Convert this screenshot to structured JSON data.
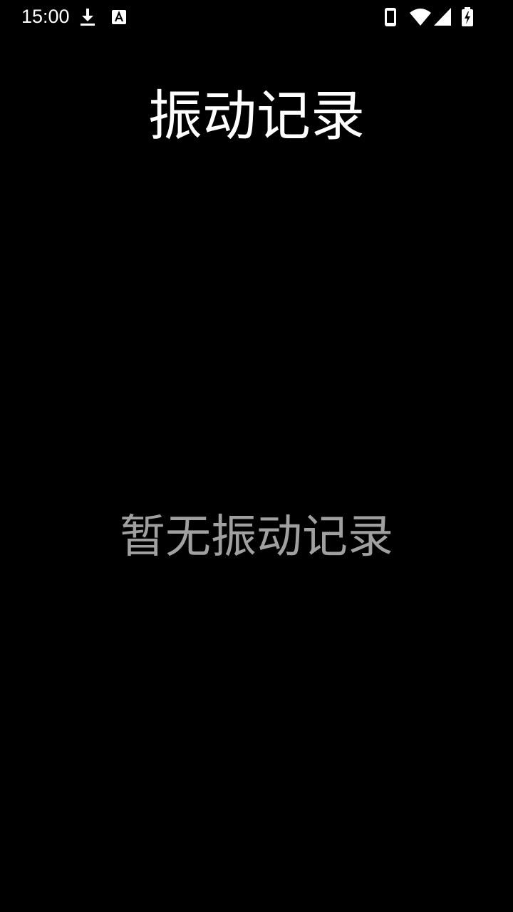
{
  "status_bar": {
    "time": "15:00",
    "icons": [
      "download-icon",
      "keyboard-a-icon",
      "phone-icon",
      "wifi-icon",
      "signal-icon",
      "battery-charging-icon"
    ]
  },
  "page": {
    "title": "振动记录",
    "empty_message": "暂无振动记录"
  },
  "colors": {
    "background": "#000000",
    "title": "#ffffff",
    "empty_text": "#a0a0a0"
  }
}
